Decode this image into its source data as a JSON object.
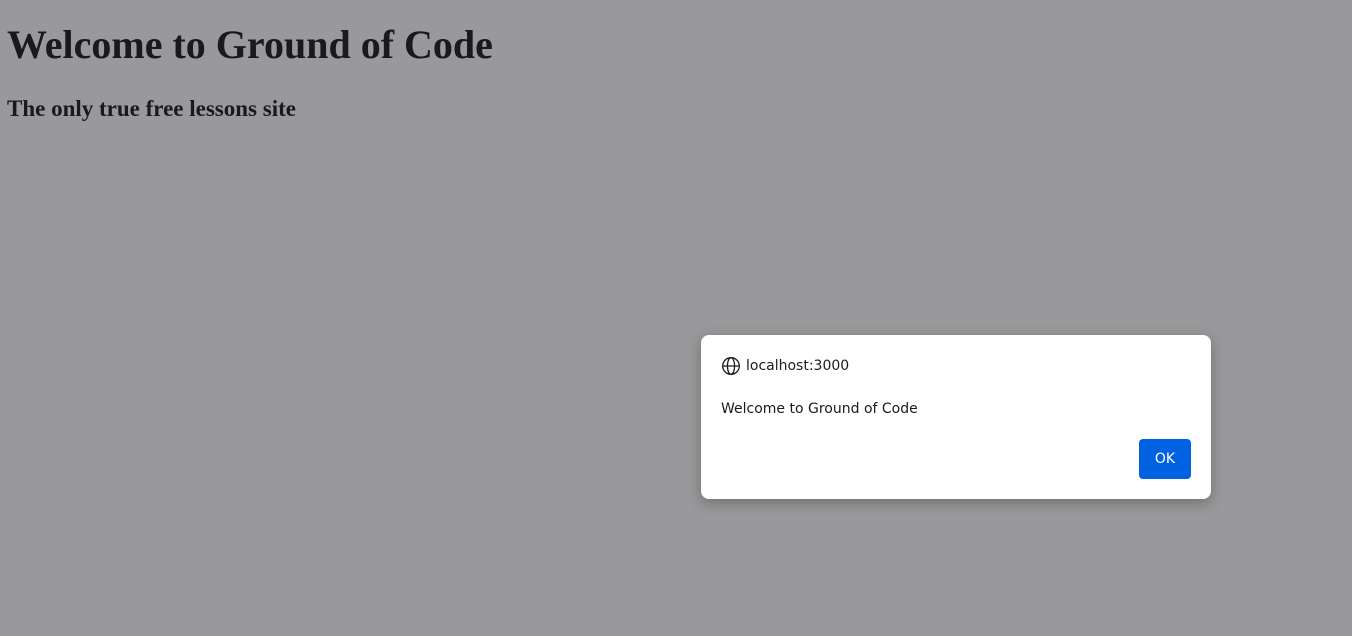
{
  "page": {
    "title": "Welcome to Ground of Code",
    "subtitle": "The only true free lessons site"
  },
  "dialog": {
    "icon": "globe-icon",
    "origin": "localhost:3000",
    "message": "Welcome to Ground of Code",
    "ok_label": "OK"
  },
  "colors": {
    "overlay": "#999999",
    "dialog_background": "#ffffff",
    "ok_button": "#0062e1",
    "ok_text": "#ffffff"
  }
}
